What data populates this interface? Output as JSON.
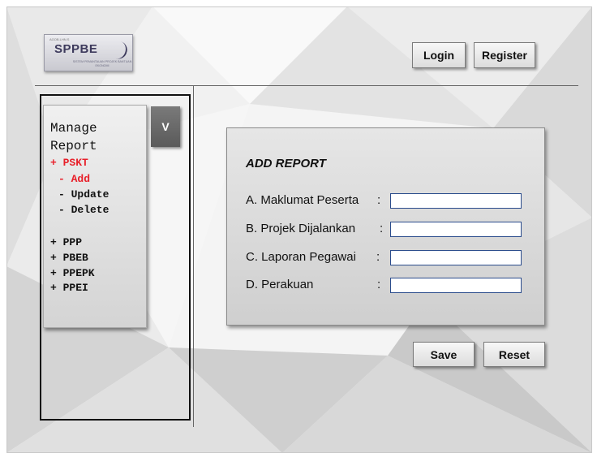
{
  "header": {
    "logo": {
      "text": "SPPBE",
      "small_text": "AGOB.LHN.S",
      "sub_text": "SISTEM PEMANTAUAN PROJEK BANTUAN EKONOMI"
    },
    "login_label": "Login",
    "register_label": "Register"
  },
  "sidebar": {
    "toggle_label": "V",
    "title_line1": "Manage",
    "title_line2": "Report",
    "items": [
      {
        "label": "+ PSKT",
        "active": true
      },
      {
        "label": "- Add",
        "active": true
      },
      {
        "label": "- Update",
        "active": false
      },
      {
        "label": "- Delete",
        "active": false
      },
      {
        "label": "+ PPP",
        "active": false
      },
      {
        "label": "+ PBEB",
        "active": false
      },
      {
        "label": "+ PPEPK",
        "active": false
      },
      {
        "label": "+ PPEI",
        "active": false
      }
    ]
  },
  "form": {
    "title": "ADD REPORT",
    "fields": [
      {
        "label": "A. Maklumat Peserta",
        "colon": ":",
        "value": ""
      },
      {
        "label": "B. Projek Dijalankan",
        "colon": ":",
        "value": ""
      },
      {
        "label": "C. Laporan Pegawai",
        "colon": ":",
        "value": ""
      },
      {
        "label": "D. Perakuan",
        "colon": ":",
        "value": ""
      }
    ],
    "save_label": "Save",
    "reset_label": "Reset"
  },
  "colors": {
    "active_menu": "#e8202a",
    "toggle_bg": "#666666",
    "input_border": "#2b4c8c"
  }
}
